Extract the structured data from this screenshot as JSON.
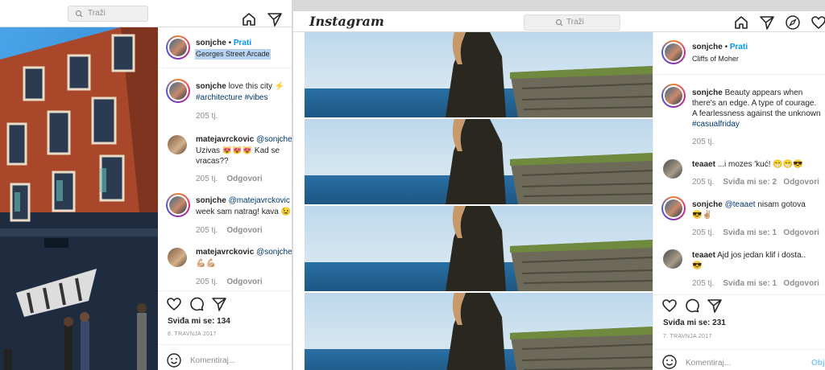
{
  "left": {
    "search_placeholder": "Traži",
    "username": "sonjche",
    "dot": "•",
    "follow": "Prati",
    "location": "Georges Street Arcade",
    "caption_text": "love this city ⚡",
    "caption_tags": "#architecture #vibes",
    "caption_time": "205 tj.",
    "comments": [
      {
        "user": "matejavrckovic",
        "mention": "@sonjche",
        "line1": "",
        "line2": "Uzivas 😻😻😻 Kad se",
        "line3": "vracas??",
        "time": "205 tj.",
        "reply": "Odgovori"
      },
      {
        "user": "sonjche",
        "mention": "@matejavrckovic",
        "line1": "",
        "line2": "week sam natrag! kava 😉",
        "line3": "",
        "time": "205 tj.",
        "reply": "Odgovori"
      },
      {
        "user": "matejavrckovic",
        "mention": "@sonjche",
        "line1": "",
        "line2": "💪🏼💪🏼",
        "line3": "",
        "time": "205 tj.",
        "reply": "Odgovori"
      }
    ],
    "likes": "Sviđa mi se: 134",
    "date": "8. TRAVNJA 2017",
    "comment_placeholder": "Komentiraj..."
  },
  "right": {
    "logo": "Instagram",
    "search_placeholder": "Traži",
    "username": "sonjche",
    "dot": "•",
    "follow": "Prati",
    "location": "Cliffs of Moher",
    "caption_line1": "Beauty appears when",
    "caption_line2": "there's an edge. A type of courage.",
    "caption_line3": "A fearlessness against the unknown",
    "caption_tag": "#casualfriday",
    "caption_time": "205 tj.",
    "comments": [
      {
        "user": "teaaet",
        "text": "...i mozes 'kuć! 😁😁😎",
        "time": "205 tj.",
        "likes": "Sviđa mi se: 2",
        "reply": "Odgovori"
      },
      {
        "user": "sonjche",
        "mention": "@teaaet",
        "text": "nisam gotova",
        "line2": "😎✌🏼",
        "time": "205 tj.",
        "likes": "Sviđa mi se: 1",
        "reply": "Odgovori"
      },
      {
        "user": "teaaet",
        "text": "Ajd jos jedan klif i dosta..",
        "line2": "😎",
        "time": "205 tj.",
        "likes": "Sviđa mi se: 1",
        "reply": "Odgovori"
      }
    ],
    "likes": "Sviđa mi se: 231",
    "date": "7. TRAVNJA 2017",
    "comment_placeholder": "Komentiraj...",
    "publish": "Obj"
  },
  "colors": {
    "accent": "#0095f6",
    "tag": "#00376b",
    "muted": "#8e8e8e"
  }
}
